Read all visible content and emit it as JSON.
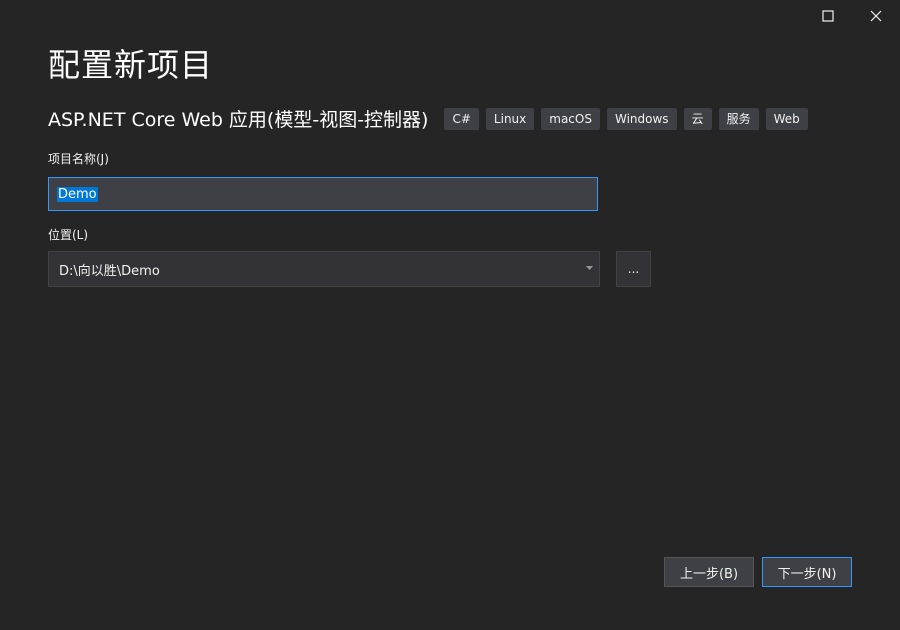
{
  "title": "配置新项目",
  "template_name": "ASP.NET Core Web 应用(模型-视图-控制器)",
  "tags": [
    "C#",
    "Linux",
    "macOS",
    "Windows",
    "云",
    "服务",
    "Web"
  ],
  "project_name": {
    "label": "项目名称(J)",
    "value": "Demo"
  },
  "location": {
    "label": "位置(L)",
    "value": "D:\\向以胜\\Demo",
    "browse_label": "..."
  },
  "buttons": {
    "previous": "上一步(B)",
    "next": "下一步(N)"
  },
  "window_controls": [
    "maximize-icon",
    "close-icon"
  ]
}
